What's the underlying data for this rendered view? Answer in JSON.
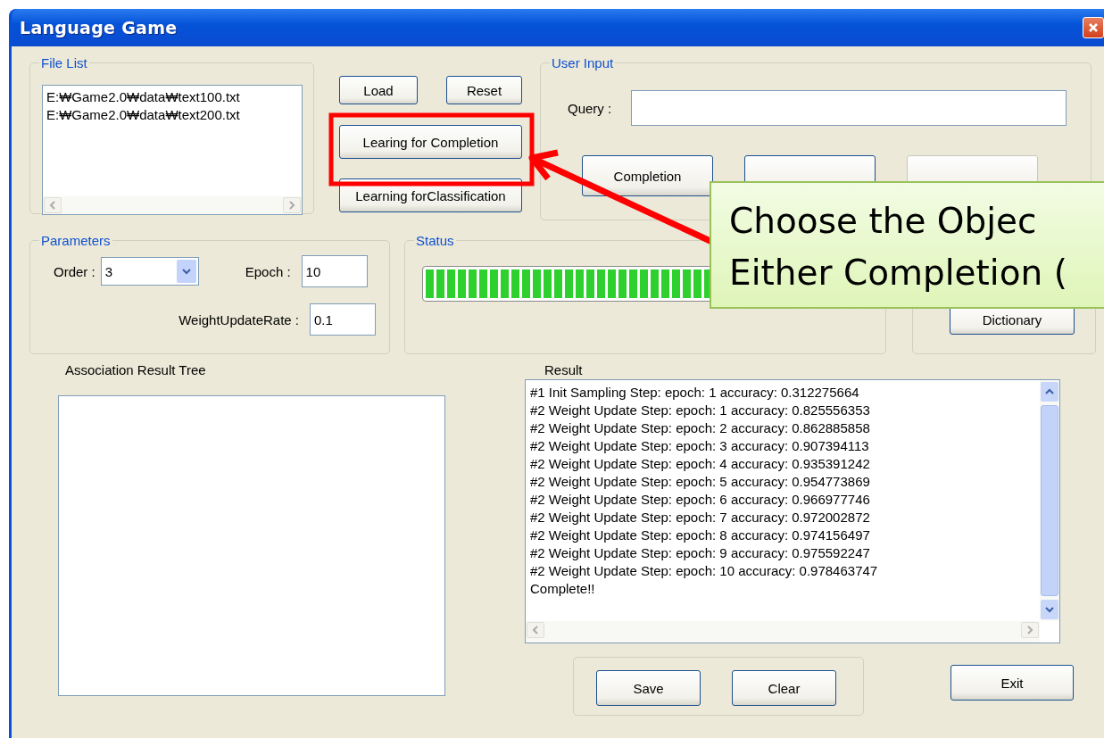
{
  "window": {
    "title": "Language Game"
  },
  "file_list": {
    "label": "File List",
    "items": [
      "E:₩Game2.0₩data₩text100.txt",
      "E:₩Game2.0₩data₩text200.txt"
    ]
  },
  "actions": {
    "load": "Load",
    "reset": "Reset",
    "learn_completion": "Learing for Completion",
    "learn_classification": "Learning forClassification"
  },
  "user_input": {
    "label": "User Input",
    "query_label": "Query :",
    "buttons": [
      {
        "label": "Completion",
        "disabled": false
      },
      {
        "disabled": false
      },
      {
        "disabled": true
      }
    ]
  },
  "parameters": {
    "label": "Parameters",
    "order_label": "Order :",
    "order_value": "3",
    "epoch_label": "Epoch :",
    "epoch_value": "10",
    "rate_label": "WeightUpdateRate :",
    "rate_value": "0.1"
  },
  "status": {
    "label": "Status",
    "level": 1
  },
  "dictionary_button": "Dictionary",
  "tree": {
    "label": "Association Result Tree"
  },
  "result": {
    "label": "Result",
    "lines": [
      "#1 Init Sampling Step: epoch: 1 accuracy: 0.312275664",
      "#2 Weight Update Step: epoch: 1 accuracy: 0.825556353",
      "#2 Weight Update Step: epoch: 2 accuracy: 0.862885858",
      "#2 Weight Update Step: epoch: 3 accuracy: 0.907394113",
      "#2 Weight Update Step: epoch: 4 accuracy: 0.935391242",
      "#2 Weight Update Step: epoch: 5 accuracy: 0.954773869",
      "#2 Weight Update Step: epoch: 6 accuracy: 0.966977746",
      "#2 Weight Update Step: epoch: 7 accuracy: 0.972002872",
      "#2 Weight Update Step: epoch: 8 accuracy: 0.974156497",
      "#2 Weight Update Step: epoch: 9 accuracy: 0.975592247",
      "#2 Weight Update Step: epoch: 10 accuracy: 0.978463747",
      "Complete!!"
    ]
  },
  "bottom_buttons": [
    "Save",
    "Clear"
  ],
  "exit_button": "Exit",
  "callout": {
    "lines": [
      "Choose the Objec",
      "Either Completion ("
    ]
  }
}
